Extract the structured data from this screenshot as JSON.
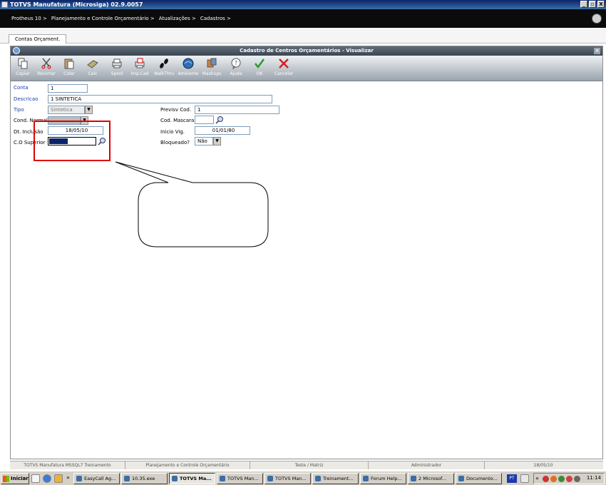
{
  "window": {
    "title": "TOTVS Manufatura (Microsiga) 02.9.0057",
    "controls": [
      "_",
      "▫",
      "X"
    ]
  },
  "breadcrumb": [
    "Protheus 10 >",
    "Planejamento e Controle Orçamentário >",
    "Atualizações >",
    "Cadastros >"
  ],
  "tab": {
    "label": "Contas Orçament."
  },
  "dialog": {
    "title": "Cadastro de Centros Orçamentários - Visualizar",
    "close": "×"
  },
  "toolbar": [
    {
      "name": "copy",
      "label": "Copiar"
    },
    {
      "name": "cut",
      "label": "Recortar"
    },
    {
      "name": "paste",
      "label": "Colar"
    },
    {
      "name": "calc",
      "label": "Calc"
    },
    {
      "name": "spool",
      "label": "Spool"
    },
    {
      "name": "impcad",
      "label": "Imp.Cad"
    },
    {
      "name": "walkthru",
      "label": "WalkThru"
    },
    {
      "name": "ambiente",
      "label": "Ambiente"
    },
    {
      "name": "mashups",
      "label": "Mashups"
    },
    {
      "name": "ajuda",
      "label": "Ajuda"
    },
    {
      "name": "ok",
      "label": "OK"
    },
    {
      "name": "cancelar",
      "label": "Cancelar"
    }
  ],
  "form": {
    "conta": {
      "label": "Conta",
      "value": "1"
    },
    "descricao": {
      "label": "Descricao",
      "value": "1 SINTETICA"
    },
    "tipo": {
      "label": "Tipo",
      "value": "Sintetica"
    },
    "cond_normal": {
      "label": "Cond. Normal",
      "value": ""
    },
    "dt_inclusao": {
      "label": "Dt. Inclusão",
      "value": "18/05/10"
    },
    "co_superior": {
      "label": "C.O Superior",
      "value": ""
    },
    "previsao_cod": {
      "label": "Previsv Cod.",
      "value": "1"
    },
    "cod_mascara": {
      "label": "Cod. Mascara",
      "value": ""
    },
    "inicio_vig": {
      "label": "Inicio Vig.",
      "value": "01/01/80"
    },
    "bloqueado": {
      "label": "Bloqueado?",
      "value": "Não"
    }
  },
  "statusbar": [
    "TOTVS Manufatura MSSQL7 Treinamento",
    "Planejamento e Controle Orçamentário",
    "Teste / Matriz",
    "Administrador",
    "18/05/10"
  ],
  "taskbar": {
    "start": "Iniciar",
    "items": [
      {
        "label": "EasyCall Ag...",
        "active": false
      },
      {
        "label": "10.35.exe",
        "active": false
      },
      {
        "label": "TOTVS Ma...",
        "active": true
      },
      {
        "label": "TOTVS Man...",
        "active": false
      },
      {
        "label": "TOTVS Man...",
        "active": false
      },
      {
        "label": "Treinament...",
        "active": false
      },
      {
        "label": "Forum Help...",
        "active": false
      },
      {
        "label": "2 Microsof...",
        "active": false
      },
      {
        "label": "Documento...",
        "active": false
      }
    ],
    "lang": "PT",
    "clock": "11:14"
  }
}
